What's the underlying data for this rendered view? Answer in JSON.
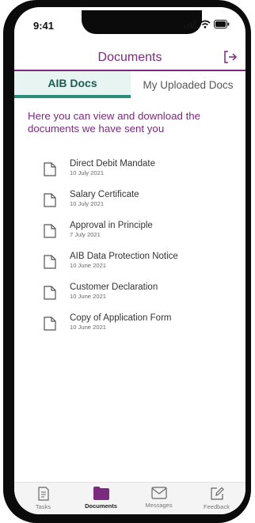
{
  "status_bar": {
    "time": "9:41"
  },
  "header": {
    "title": "Documents",
    "logout_icon": "logout-icon"
  },
  "tabs": [
    {
      "label": "AIB Docs",
      "active": true
    },
    {
      "label": "My Uploaded Docs",
      "active": false
    }
  ],
  "intro_text": "Here you can view and download the documents we have sent you",
  "documents": [
    {
      "name": "Direct Debit Mandate",
      "date": "10 July 2021"
    },
    {
      "name": "Salary Certificate",
      "date": "10 July 2021"
    },
    {
      "name": "Approval in Principle",
      "date": "7 July 2021"
    },
    {
      "name": "AIB Data Protection Notice",
      "date": "10 June 2021"
    },
    {
      "name": "Customer Declaration",
      "date": "10 June 2021"
    },
    {
      "name": "Copy of Application Form",
      "date": "10 June 2021"
    }
  ],
  "bottom_nav": [
    {
      "label": "Tasks",
      "icon": "tasks-icon",
      "active": false
    },
    {
      "label": "Documents",
      "icon": "folder-icon",
      "active": true
    },
    {
      "label": "Messages",
      "icon": "envelope-icon",
      "active": false
    },
    {
      "label": "Feedback",
      "icon": "feedback-icon",
      "active": false
    }
  ],
  "colors": {
    "brand_purple": "#7b2a7e",
    "active_tab_green": "#2b8c7d",
    "active_tab_bg": "#e7f4f1"
  }
}
